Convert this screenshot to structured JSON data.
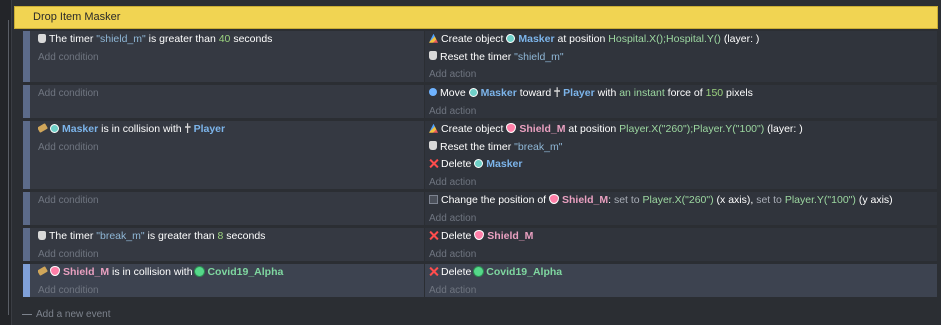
{
  "group": {
    "title": "Drop Item Masker"
  },
  "placeholders": {
    "add_condition": "Add condition",
    "add_action": "Add action",
    "add_event": "Add a new event"
  },
  "events": [
    {
      "conditions": [
        {
          "pre": "The timer ",
          "str": "\"shield_m\"",
          "mid": " is greater than ",
          "num": "40",
          "post": " seconds"
        }
      ],
      "actions": [
        {
          "pre": "Create object ",
          "obj": "Masker",
          "mid": " at position ",
          "expr": "Hospital.X();Hospital.Y()",
          "post": " (layer: )"
        },
        {
          "pre": "Reset the timer ",
          "str": "\"shield_m\""
        }
      ]
    },
    {
      "conditions": [],
      "actions": [
        {
          "pre": "Move ",
          "obj": "Masker",
          "mid": " toward ",
          "obj2": "Player",
          "mid2": " with ",
          "expr": "an instant",
          "mid3": " force of ",
          "num": "150",
          "post": " pixels"
        }
      ]
    },
    {
      "conditions": [
        {
          "obj": "Masker",
          "mid": " is in collision with ",
          "obj2": "Player"
        }
      ],
      "actions": [
        {
          "pre": "Create object ",
          "obj": "Shield_M",
          "mid": " at position ",
          "expr": "Player.X(\"260\");Player.Y(\"100\")",
          "post": " (layer: )"
        },
        {
          "pre": "Reset the timer ",
          "str": "\"break_m\""
        },
        {
          "pre": "Delete ",
          "obj": "Masker"
        }
      ]
    },
    {
      "conditions": [],
      "actions": [
        {
          "pre": "Change the position of ",
          "obj": "Shield_M",
          "mid": ": ",
          "dim1": "set to",
          "expr1": " Player.X(\"260\")",
          "mid2": " (x axis), ",
          "dim2": "set to",
          "expr2": " Player.Y(\"100\")",
          "post": " (y axis)"
        }
      ]
    },
    {
      "conditions": [
        {
          "pre": "The timer ",
          "str": "\"break_m\"",
          "mid": " is greater than ",
          "num": "8",
          "post": " seconds"
        }
      ],
      "actions": [
        {
          "pre": "Delete ",
          "obj": "Shield_M"
        }
      ]
    },
    {
      "conditions": [
        {
          "obj": "Shield_M",
          "mid": " is in collision with ",
          "obj2": "Covid19_Alpha"
        }
      ],
      "actions": [
        {
          "pre": "Delete ",
          "obj": "Covid19_Alpha"
        }
      ]
    }
  ]
}
